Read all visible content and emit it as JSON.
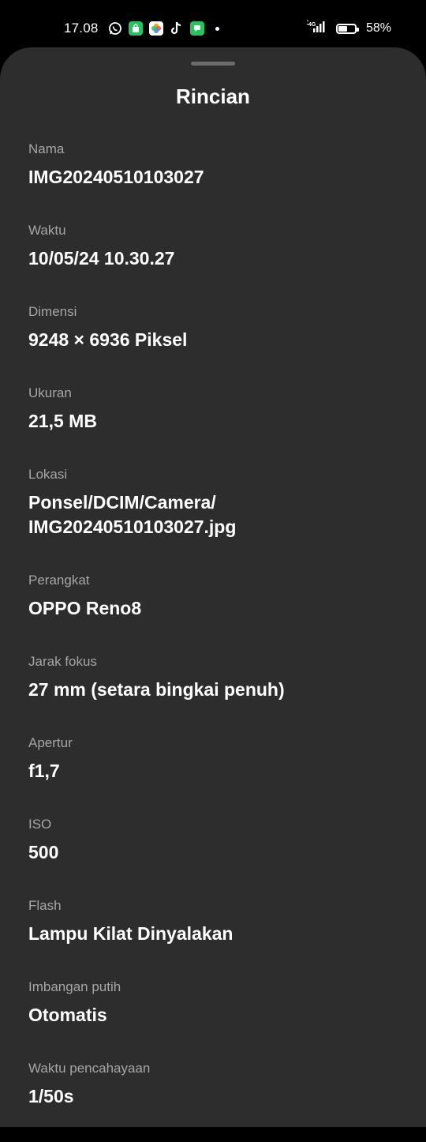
{
  "status_bar": {
    "time": "17.08",
    "notification_icons": [
      "whatsapp-icon",
      "shopping-bag-icon",
      "photos-icon",
      "tiktok-icon",
      "messages-icon"
    ],
    "network": "4G",
    "battery_percent": "58%",
    "battery_level": 0.58
  },
  "sheet": {
    "title": "Rincian",
    "rows": [
      {
        "label": "Nama",
        "value": "IMG20240510103027"
      },
      {
        "label": "Waktu",
        "value": "10/05/24 10.30.27"
      },
      {
        "label": "Dimensi",
        "value": "9248 × 6936 Piksel"
      },
      {
        "label": "Ukuran",
        "value": "21,5 MB"
      },
      {
        "label": "Lokasi",
        "value": "Ponsel/DCIM/Camera/\nIMG20240510103027.jpg"
      },
      {
        "label": "Perangkat",
        "value": "OPPO Reno8"
      },
      {
        "label": "Jarak fokus",
        "value": "27 mm (setara bingkai penuh)"
      },
      {
        "label": "Apertur",
        "value": "f1,7"
      },
      {
        "label": "ISO",
        "value": "500"
      },
      {
        "label": "Flash",
        "value": "Lampu Kilat Dinyalakan"
      },
      {
        "label": "Imbangan putih",
        "value": "Otomatis"
      },
      {
        "label": "Waktu pencahayaan",
        "value": "1/50s"
      }
    ]
  },
  "colors": {
    "background": "#000000",
    "sheet": "#2d2d2d",
    "label": "#a6a6a6",
    "value": "#ffffff"
  }
}
